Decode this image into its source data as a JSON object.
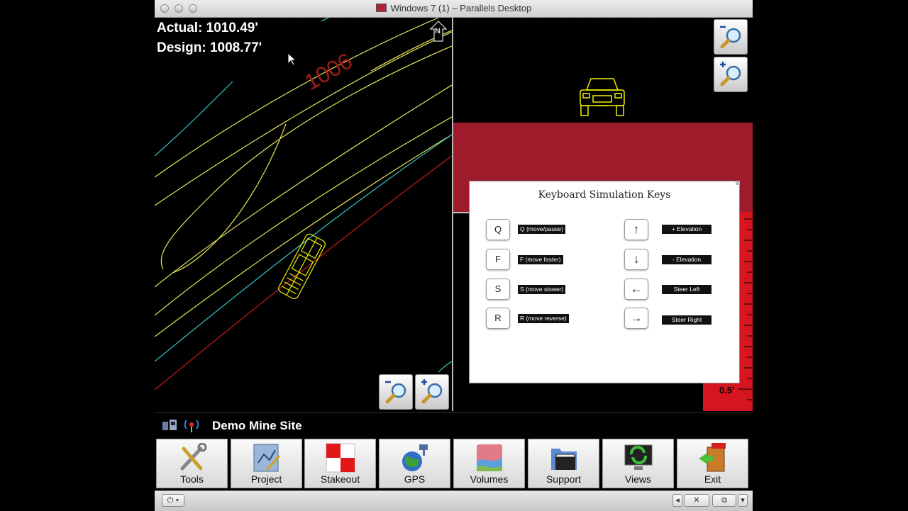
{
  "window": {
    "title": "Windows 7 (1) – Parallels Desktop"
  },
  "readout": {
    "actual": "Actual: 1010.49'",
    "design": "Design: 1008.77'"
  },
  "map": {
    "contour_label": "1006",
    "north_label": "N"
  },
  "ruler": {
    "label": "0.5'"
  },
  "dialog": {
    "title": "Keyboard Simulation Keys",
    "left_keys": [
      {
        "key": "Q",
        "label": "Q (move/pause)"
      },
      {
        "key": "F",
        "label": "F (move faster)"
      },
      {
        "key": "S",
        "label": "S (move slower)"
      },
      {
        "key": "R",
        "label": "R (move reverse)"
      }
    ],
    "right_keys": [
      {
        "key": "↑",
        "label": "+ Elevation"
      },
      {
        "key": "↓",
        "label": "- Elevation"
      },
      {
        "key": "←",
        "label": "Steer Left"
      },
      {
        "key": "→",
        "label": "Steer Right"
      }
    ]
  },
  "status": {
    "site_name": "Demo Mine Site"
  },
  "toolbar": {
    "buttons": [
      {
        "label": "Tools",
        "icon": "tools-icon"
      },
      {
        "label": "Project",
        "icon": "project-icon"
      },
      {
        "label": "Stakeout",
        "icon": "stakeout-icon"
      },
      {
        "label": "GPS",
        "icon": "gps-icon"
      },
      {
        "label": "Volumes",
        "icon": "volumes-icon"
      },
      {
        "label": "Support",
        "icon": "support-icon"
      },
      {
        "label": "Views",
        "icon": "views-icon"
      },
      {
        "label": "Exit",
        "icon": "exit-icon"
      }
    ]
  },
  "colors": {
    "contour_yellow": "#e6e65a",
    "contour_cyan": "#35c6c6",
    "boundary_red": "#c01818",
    "band_red": "#9d1b2b"
  }
}
